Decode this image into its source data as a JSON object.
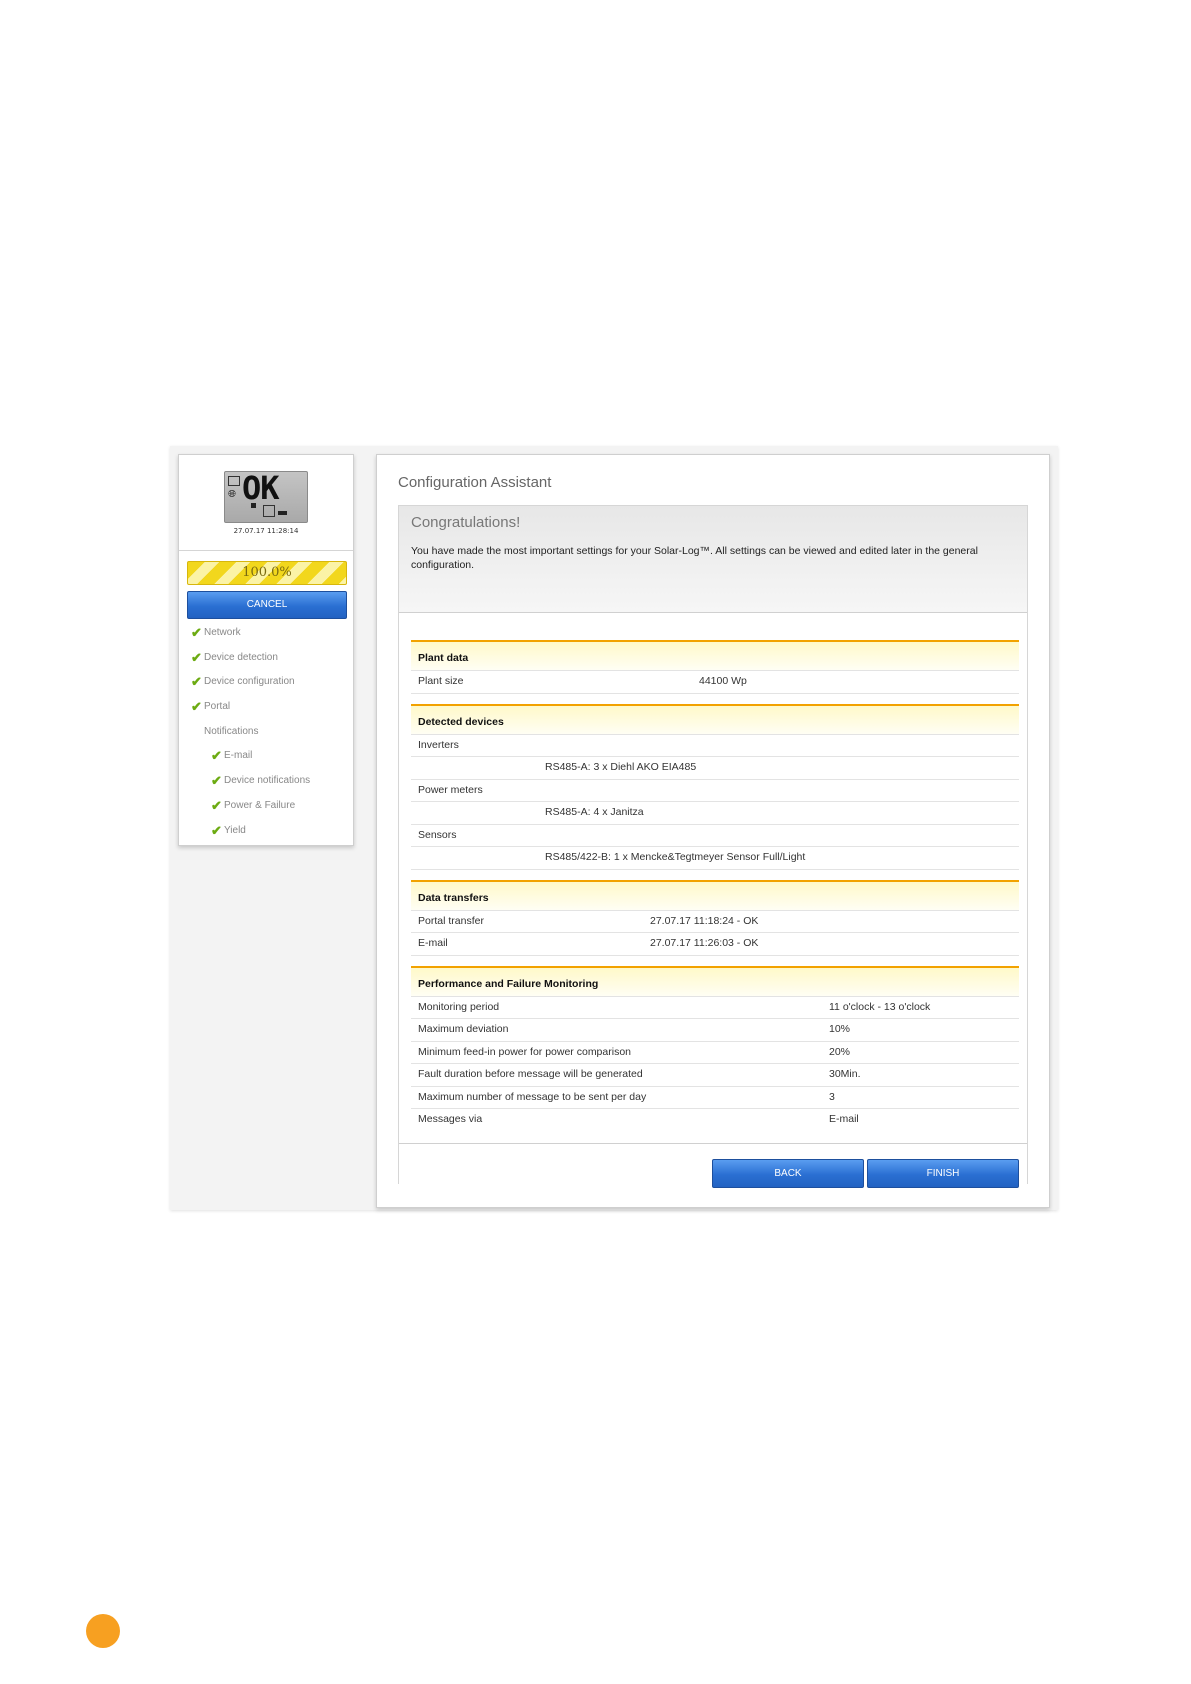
{
  "sidebar": {
    "lcd": {
      "display": "OK",
      "timestamp": "27.07.17 11:28:14"
    },
    "progress": {
      "label": "100.0%",
      "value": 100
    },
    "cancel_label": "CANCEL",
    "steps": [
      {
        "label": "Network",
        "done": true
      },
      {
        "label": "Device detection",
        "done": true
      },
      {
        "label": "Device configuration",
        "done": true
      },
      {
        "label": "Portal",
        "done": true
      },
      {
        "label": "Notifications",
        "done": false
      },
      {
        "label": "E-mail",
        "done": true
      },
      {
        "label": "Device notifications",
        "done": true
      },
      {
        "label": "Power & Failure",
        "done": true
      },
      {
        "label": "Yield",
        "done": true
      }
    ]
  },
  "main": {
    "title": "Configuration Assistant",
    "congrats_heading": "Congratulations!",
    "congrats_text": "You have made the most important settings for your Solar-Log™. All settings can be viewed and edited later in the general configuration.",
    "plant": {
      "heading": "Plant data",
      "size_label": "Plant size",
      "size_value": "44100 Wp"
    },
    "devices": {
      "heading": "Detected devices",
      "inverters_label": "Inverters",
      "inverters_value": "RS485-A: 3 x Diehl AKO EIA485",
      "meters_label": "Power meters",
      "meters_value": "RS485-A: 4 x Janitza",
      "sensors_label": "Sensors",
      "sensors_value": "RS485/422-B: 1 x Mencke&Tegtmeyer Sensor Full/Light"
    },
    "transfers": {
      "heading": "Data transfers",
      "portal_label": "Portal transfer",
      "portal_value": "27.07.17 11:18:24 - OK",
      "email_label": "E-mail",
      "email_value": "27.07.17 11:26:03 - OK"
    },
    "monitoring": {
      "heading": "Performance and Failure Monitoring",
      "rows": [
        {
          "label": "Monitoring period",
          "value": "11 o'clock - 13 o'clock"
        },
        {
          "label": "Maximum deviation",
          "value": "10%"
        },
        {
          "label": "Minimum feed-in power for power comparison",
          "value": "20%"
        },
        {
          "label": "Fault duration before message will be generated",
          "value": "30Min."
        },
        {
          "label": "Maximum number of message to be sent per day",
          "value": "3"
        },
        {
          "label": "Messages via",
          "value": "E-mail"
        }
      ]
    },
    "back_label": "BACK",
    "finish_label": "FINISH"
  },
  "colors": {
    "accent_orange": "#f2a200",
    "button_blue": "#2a6fd2",
    "check_green": "#6cab12",
    "page_dot": "#f7a021"
  }
}
